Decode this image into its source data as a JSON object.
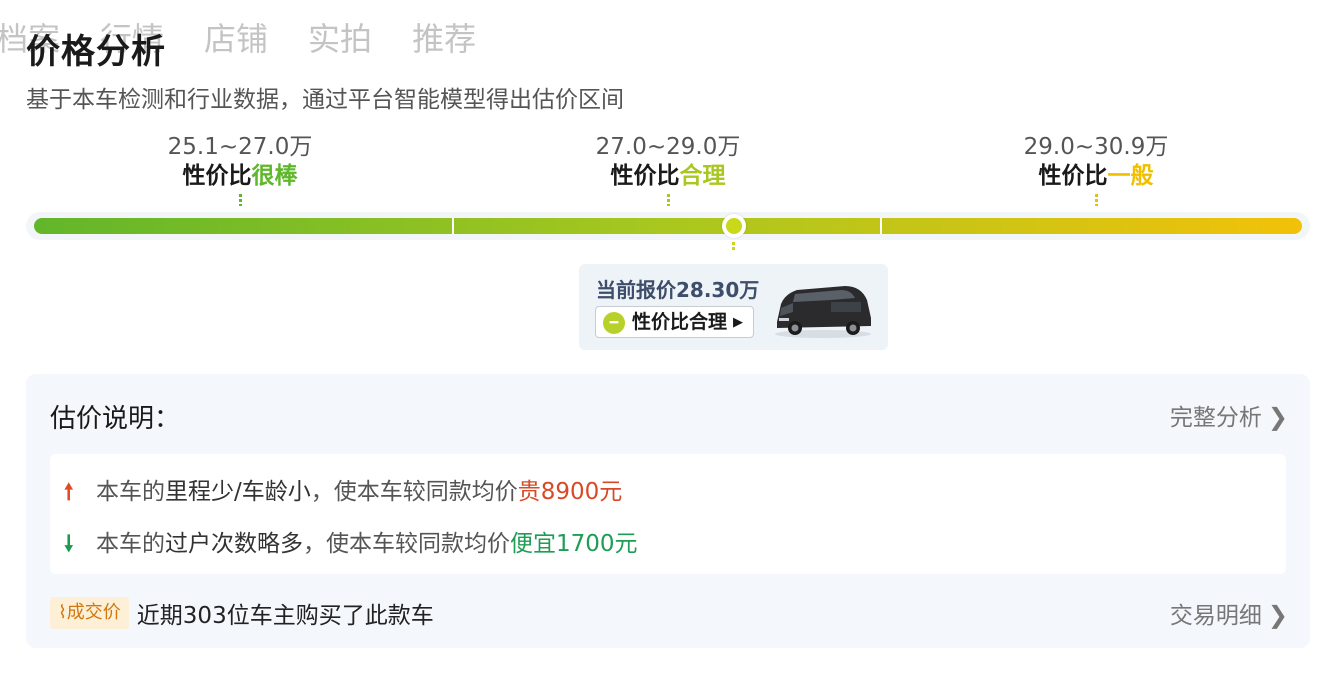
{
  "tabs": [
    "档案",
    "行情",
    "店铺",
    "实拍",
    "推荐"
  ],
  "header": {
    "title": "价格分析",
    "subtitle": "基于本车检测和行业数据，通过平台智能模型得出估价区间"
  },
  "ranges": [
    {
      "price": "25.1~27.0万",
      "prefix": "性价比",
      "level": "很棒",
      "color": "#5fb72b"
    },
    {
      "price": "27.0~29.0万",
      "prefix": "性价比",
      "level": "合理",
      "color": "#a8c820"
    },
    {
      "price": "29.0~30.9万",
      "prefix": "性价比",
      "level": "一般",
      "color": "#f0c000"
    }
  ],
  "current": {
    "label": "当前报价",
    "value": "28.30万",
    "badge": "性价比合理",
    "badge_icon": "minus-circle-icon",
    "image": "black-mpv-van"
  },
  "explain": {
    "heading": "估价说明：",
    "full_link": "完整分析",
    "reasons": [
      {
        "direction": "up",
        "prefix": "本车的",
        "factor": "里程少/车龄小",
        "middle": "，使本车较同款均价",
        "effect": "贵8900元"
      },
      {
        "direction": "down",
        "prefix": "本车的",
        "factor": "过户次数略多",
        "middle": "，使本车较同款均价",
        "effect": "便宜1700元"
      }
    ],
    "deal_tag": "成交价",
    "deal_text": "近期303位车主购买了此款车",
    "deal_link": "交易明细"
  },
  "colors": {
    "great": "#5fb72b",
    "fair": "#a8c820",
    "average": "#f0c000",
    "up": "#d84a26",
    "down": "#1f9d55"
  }
}
